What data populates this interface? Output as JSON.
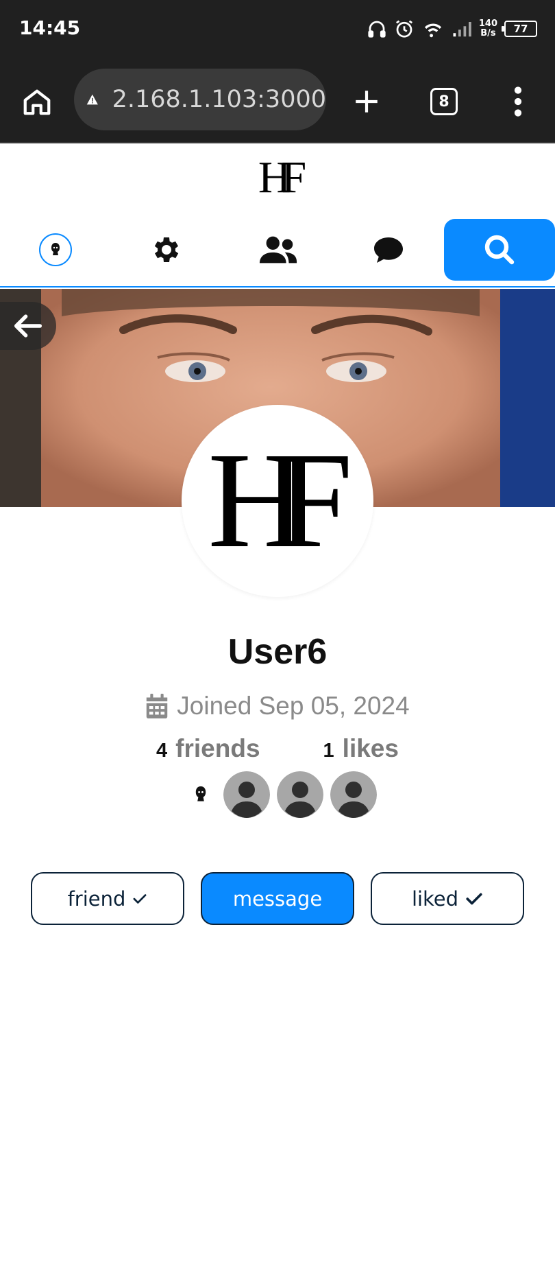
{
  "status_bar": {
    "time": "14:45",
    "net_speed_value": "140",
    "net_speed_unit": "B/s",
    "battery": "77"
  },
  "browser": {
    "url": "2.168.1.103:3000",
    "tab_count": "8"
  },
  "app": {
    "logo": "HF",
    "brand_color": "#0a8aff"
  },
  "nav": {
    "items": [
      "avatar-icon",
      "gear-icon",
      "users-icon",
      "chat-icon",
      "search-icon"
    ]
  },
  "profile": {
    "avatar_monogram": "HF",
    "username": "User6",
    "joined": "Joined Sep 05, 2024",
    "friends_count": "4",
    "friends_label": "friends",
    "likes_count": "1",
    "likes_label": "likes"
  },
  "actions": {
    "friend_label": "friend",
    "message_label": "message",
    "liked_label": "liked"
  }
}
